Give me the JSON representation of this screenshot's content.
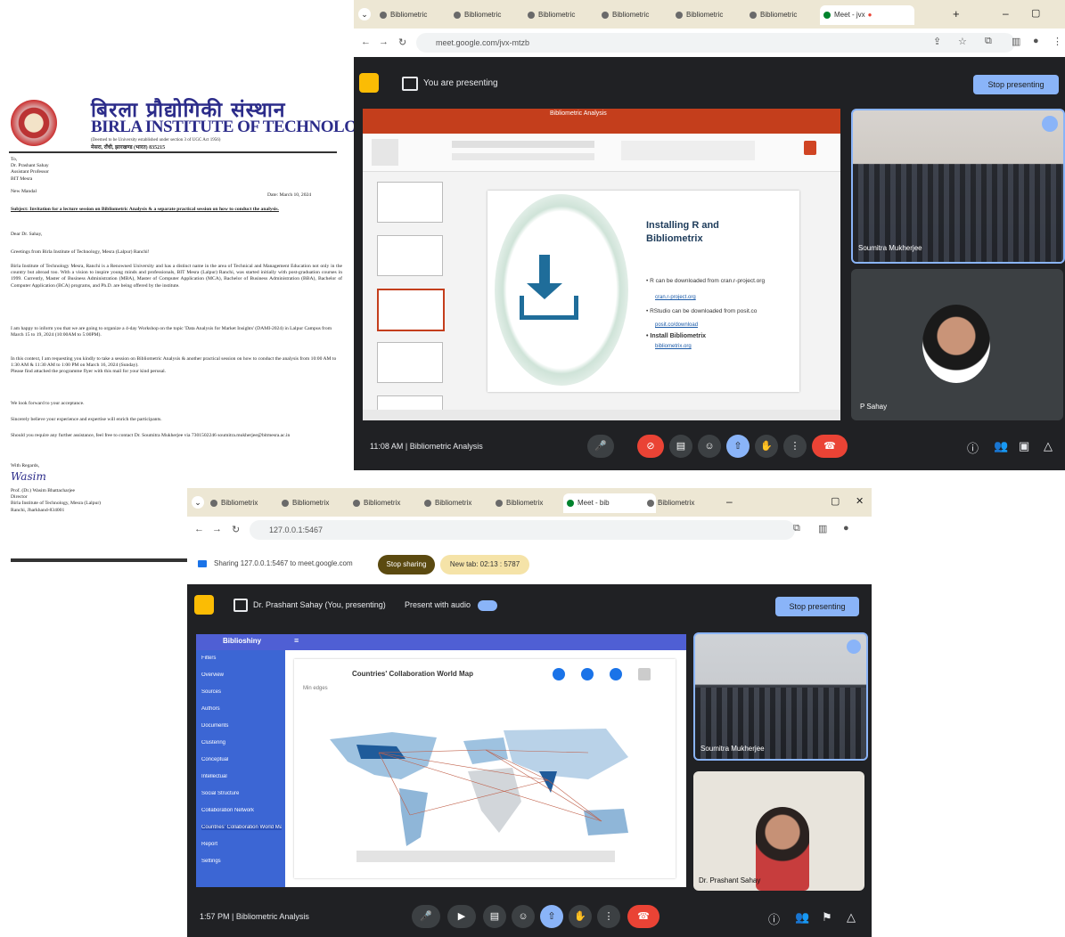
{
  "letter": {
    "hindi_name": "बिरला प्रौद्योगिकी संस्थान",
    "english_name": "BIRLA INSTITUTE OF TECHNOLOGY",
    "address_line": "मेसरा, राँची, झारखण्ड (भारत) 835215",
    "to_block": "To,\nDr. Prashant Sahay\nAssistant Professor\nBIT Mesra\n\nNew Mandal",
    "date": "Date: March 10, 2024",
    "subject": "Subject: Invitation for a lecture session on Bibliometric Analysis & a separate practical session on how to conduct the analysis.",
    "salutation": "Dear Dr. Sahay,",
    "greeting": "Greetings from Birla Institute of Technology, Mesra (Lalpur) Ranchi!",
    "para1": "Birla Institute of Technology Mesra, Ranchi is a Renowned University and has a distinct name in the area of Technical and Management Education not only in the country but abroad too. With a vision to inspire young minds and professionals, BIT Mesra (Lalpur) Ranchi, was started initially with post-graduation courses in 1999. Currently, Master of Business Administration (MBA), Master of Computer Application (MCA), Bachelor of Business Administration (BBA), Bachelor of Computer Application (BCA) programs, and Ph.D. are being offered by the institute.",
    "para2": "I am happy to inform you that we are going to organize a 4-day Workshop on the topic 'Data Analysis for Market Insights' (DAMI-2024) in Lalpur Campus from March 15 to 19, 2024 (10:00AM to 5:00PM).",
    "para3": "In this context, I am requesting you kindly to take a session on Bibliometric Analysis & another practical session on how to conduct the analysis from 10:00 AM to 1:30 AM & 11:30 AM to 1:00 PM on March 16, 2024 (Sunday).\nPlease find attached the programme flyer with this mail for your kind perusal.",
    "para4": "We look forward to your acceptance.",
    "para5": "Sincerely believe your experience and expertise will enrich the participants.",
    "para6": "Should you require any further assistance, feel free to contact Dr. Soumitra Mukherjee via 7301502246 soumitra.mukherjee@bitmesra.ac.in",
    "closing": "With Regards,",
    "signature": "Wasim",
    "signatory": "Prof. (Dr.) Wasim Bhattacharjee\nDirector\nBirla Institute of Technology, Mesra (Lalpur)\nRanchi, Jharkhand-834001"
  },
  "win1": {
    "tabs": [
      "Bibliometric",
      "Bibliometric",
      "Bibliometric",
      "Bibliometric",
      "Bibliometric",
      "Bibliometric",
      "Meet - jvx"
    ],
    "url": "meet.google.com/jvx-mtzb",
    "presenting_label": "You are presenting",
    "stop_label": "Stop presenting",
    "ppt_title": "Bibliometric Analysis",
    "slide_title": "Installing R and Bibliometrix",
    "bullets": [
      "R can be downloaded from cran.r-project.org",
      "RStudio can be downloaded from posit.co",
      "Install Bibliometrix"
    ],
    "links": [
      "cran.r-project.org",
      "posit.co/download",
      "bibliometrix.org"
    ],
    "tile1_name": "Soumitra Mukherjee",
    "tile2_name": "P Sahay",
    "time": "11:08 AM",
    "meeting_name": "Bibliometric Analysis"
  },
  "win2": {
    "tabs": [
      "Bibliometrix",
      "Bibliometrix",
      "Bibliometrix",
      "Bibliometrix",
      "Bibliometrix",
      "Meet - bib",
      "Bibliometrix"
    ],
    "url": "127.0.0.1:5467",
    "sharing_text": "Sharing 127.0.0.1:5467 to meet.google.com",
    "stop_sharing": "Stop sharing",
    "hide_label": "New tab: 02:13 : 5787",
    "presenting_label": "Dr. Prashant Sahay (You, presenting)",
    "present_audio": "Present with audio",
    "stop_label": "Stop presenting",
    "app_name": "Biblioshiny",
    "sidebar": [
      "Filters",
      "Overview",
      "Sources",
      "Authors",
      "Documents",
      "Clustering",
      "Conceptual",
      "Intellectual",
      "Social Structure",
      "Collaboration Network",
      "Countries' Collaboration World Map",
      "Report",
      "Settings"
    ],
    "map_title": "Countries' Collaboration World Map",
    "map_sub": "Min edges",
    "tile1_name": "Soumitra Mukherjee",
    "tile2_name": "Dr. Prashant Sahay",
    "time": "1:57 PM",
    "meeting_name": "Bibliometric Analysis"
  }
}
